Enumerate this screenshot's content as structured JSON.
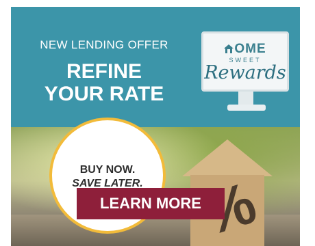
{
  "ad": {
    "offer_label": "NEW LENDING OFFER",
    "headline_line1": "REFINE",
    "headline_line2": "YOUR RATE",
    "badge_line1": "BUY NOW.",
    "badge_line2": "SAVE LATER.",
    "cta_label": "LEARN MORE",
    "percent_symbol": "%"
  },
  "logo": {
    "home": "OME",
    "sweet": "SWEET",
    "rewards": "Rewards",
    "home_icon": "house-icon"
  },
  "colors": {
    "banner_teal": "#3c95a9",
    "cta_maroon": "#8e1f3a",
    "badge_border": "#f2bb3a",
    "logo_teal": "#3a7f8e"
  }
}
